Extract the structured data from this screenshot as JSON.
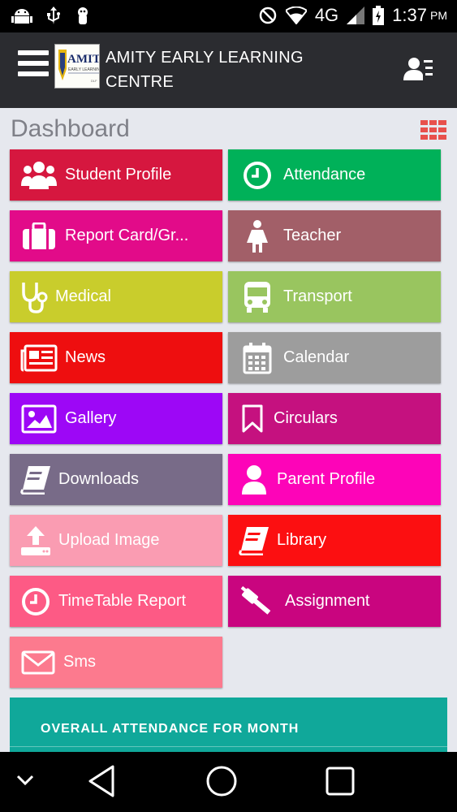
{
  "status_bar": {
    "network": "4G",
    "time": "1:37",
    "ampm": "PM",
    "icons": [
      "android-icon",
      "usb-icon",
      "debug-icon",
      "dnd-icon",
      "wifi-icon",
      "signal-icon",
      "battery-icon"
    ]
  },
  "header": {
    "title": "AMITY EARLY LEARNING CENTRE",
    "logo_text": "AMITY",
    "logo_sub": "EARLY LEARNING CENTRE"
  },
  "dashboard": {
    "title": "Dashboard",
    "tiles": [
      {
        "label": "Student Profile",
        "color": "#d6173f",
        "icon": "users-icon"
      },
      {
        "label": "Attendance",
        "color": "#00b159",
        "icon": "clock-icon"
      },
      {
        "label": "Report Card/Gr...",
        "color": "#e20b89",
        "icon": "briefcase-icon"
      },
      {
        "label": "Teacher",
        "color": "#a25f68",
        "icon": "teacher-icon"
      },
      {
        "label": "Medical",
        "color": "#c9cd2c",
        "icon": "stethoscope-icon"
      },
      {
        "label": "Transport",
        "color": "#99c55f",
        "icon": "bus-icon"
      },
      {
        "label": "News",
        "color": "#ee0e0f",
        "icon": "newspaper-icon"
      },
      {
        "label": "Calendar",
        "color": "#9d9d9d",
        "icon": "calendar-icon"
      },
      {
        "label": "Gallery",
        "color": "#9d07f6",
        "icon": "image-icon"
      },
      {
        "label": "Circulars",
        "color": "#c5117f",
        "icon": "bookmark-icon"
      },
      {
        "label": "Downloads",
        "color": "#786b88",
        "icon": "book-icon"
      },
      {
        "label": "Parent Profile",
        "color": "#fd04b8",
        "icon": "user-icon"
      },
      {
        "label": "Upload Image",
        "color": "#fa9cb2",
        "icon": "upload-icon"
      },
      {
        "label": "Library",
        "color": "#fc0f11",
        "icon": "library-icon"
      },
      {
        "label": "TimeTable Report",
        "color": "#fd5a85",
        "icon": "clock-icon"
      },
      {
        "label": "Assignment",
        "color": "#c9057f",
        "icon": "gavel-icon"
      },
      {
        "label": "Sms",
        "color": "#fc7a8e",
        "icon": "envelope-icon"
      }
    ]
  },
  "attendance": {
    "title": "OVERALL ATTENDANCE FOR  MONTH",
    "color": "#10a89a"
  },
  "nav": {
    "buttons": [
      "chevron-down-icon",
      "back-icon",
      "home-icon",
      "recents-icon"
    ]
  }
}
